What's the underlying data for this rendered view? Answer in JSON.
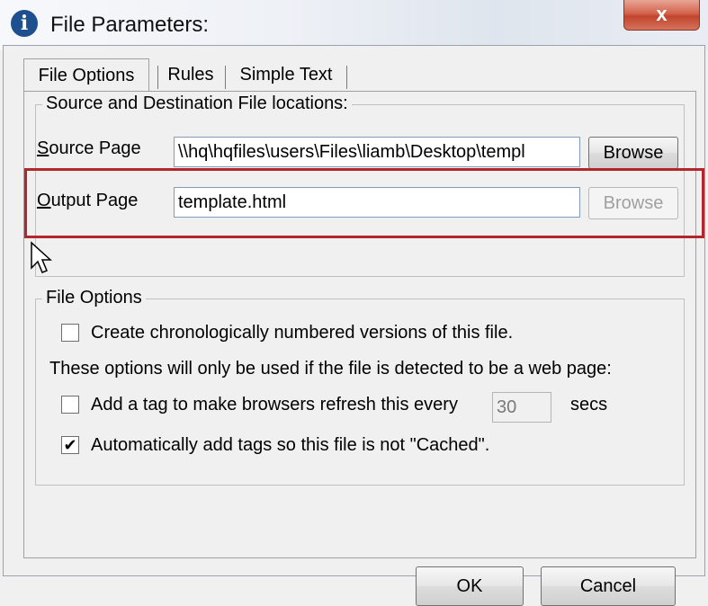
{
  "window": {
    "title": "File Parameters:",
    "close_label": "x",
    "icon": "info-icon"
  },
  "tabs": [
    {
      "label": "File Options",
      "active": true
    },
    {
      "label": "Rules",
      "active": false
    },
    {
      "label": "Simple Text",
      "active": false
    }
  ],
  "locations_group": {
    "legend": "Source and Destination File locations:",
    "source": {
      "label_first": "S",
      "label_rest": "ource Page",
      "value": "\\\\hq\\hqfiles\\users\\Files\\liamb\\Desktop\\templ",
      "browse_label": "Browse"
    },
    "output": {
      "label_first": "O",
      "label_rest": "utput Page",
      "value": "template.html",
      "browse_label": "Browse"
    }
  },
  "options_group": {
    "legend": "File Options",
    "chrono_label": "Create chronologically numbered versions of this file.",
    "chrono_checked": false,
    "web_note": "These options will only be used if the file is detected to be a web page:",
    "refresh_label": "Add a tag to make browsers refresh this every",
    "refresh_checked": false,
    "refresh_value": "30",
    "refresh_unit": "secs",
    "cache_label": "Automatically add tags so this file is not \"Cached\".",
    "cache_checked": true
  },
  "footer": {
    "ok_label": "OK",
    "cancel_label": "Cancel"
  },
  "colors": {
    "highlight": "#b3262c",
    "close_button": "#c1452c"
  }
}
